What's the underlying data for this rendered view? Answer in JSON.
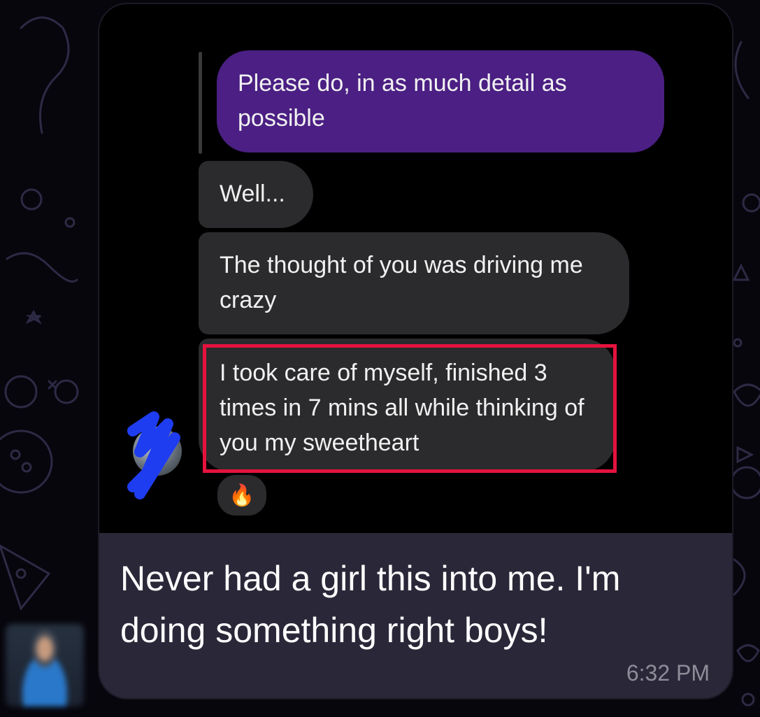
{
  "chat_screenshot": {
    "quoted_message": "Please do, in as much detail as possible",
    "messages": [
      {
        "text": "Well..."
      },
      {
        "text": "The thought of you was driving me crazy"
      },
      {
        "text": "I took care of myself, finished 3 times in 7 mins all while thinking of you my sweetheart"
      }
    ],
    "reaction": "🔥",
    "highlight_color": "#e5123d",
    "bubble_purple": "#4b1f83",
    "bubble_gray": "#2b2b2d"
  },
  "post": {
    "caption": "Never had a girl this into me. I'm doing something right boys!",
    "time": "6:32 PM"
  },
  "icons": [
    "redacted-avatar-icon",
    "fire-emoji-icon",
    "poster-avatar"
  ]
}
